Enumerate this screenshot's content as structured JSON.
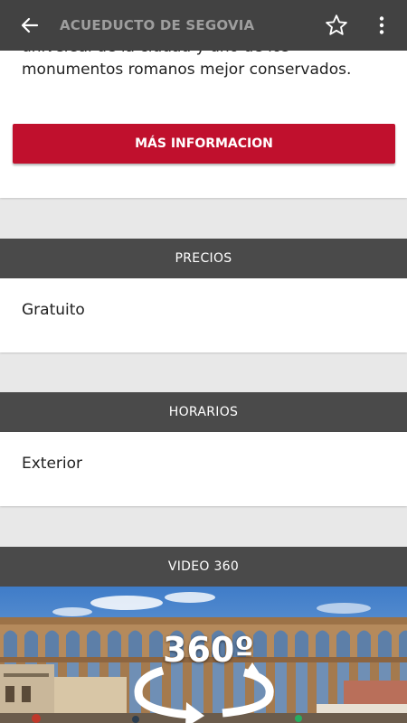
{
  "toolbar": {
    "title": "ACUEDUCTO DE SEGOVIA",
    "back_icon": "arrow-left-icon",
    "favorite_icon": "star-outline-icon",
    "menu_icon": "more-vert-icon"
  },
  "description": {
    "text_line_1": "universal de la ciudad y uno de los",
    "text_line_2": "monumentos romanos mejor conservados.",
    "more_button": "MÁS INFORMACION"
  },
  "sections": {
    "prices": {
      "header": "PRECIOS",
      "value": "Gratuito"
    },
    "hours": {
      "header": "HORARIOS",
      "value": "Exterior"
    },
    "video": {
      "header": "VIDEO 360",
      "badge": "360º"
    }
  },
  "colors": {
    "toolbar_bg": "#424242",
    "accent_red": "#c0102d",
    "section_header_bg": "#4a4a4a",
    "page_bg": "#e8e8e8"
  }
}
